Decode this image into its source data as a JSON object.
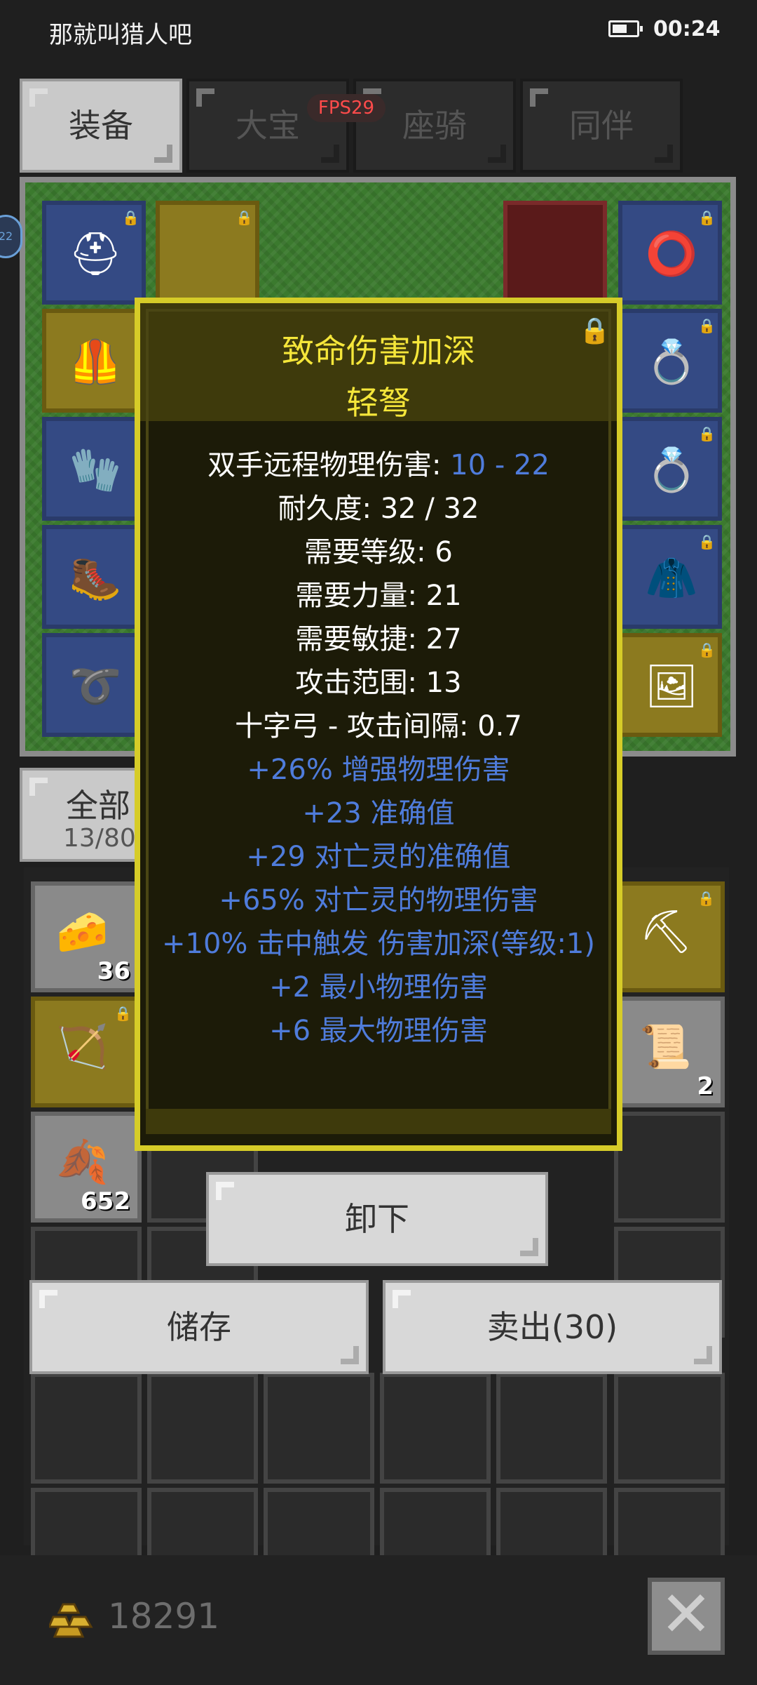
{
  "status_bar": {
    "title": "那就叫猎人吧",
    "time": "00:24"
  },
  "tabs": [
    {
      "label": "装备",
      "active": true
    },
    {
      "label": "大宝",
      "active": false
    },
    {
      "label": "座骑",
      "active": false
    },
    {
      "label": "同伴",
      "active": false
    }
  ],
  "fps": "FPS29",
  "side_badge": "22",
  "inventory": {
    "filter_label": "全部",
    "count": "13/80",
    "quantities": [
      "36",
      "652",
      "2"
    ]
  },
  "tooltip": {
    "title": "致命伤害加深",
    "item_name": "轻弩",
    "base_lines": [
      {
        "label": "双手远程物理伤害: ",
        "value": "10 - 22"
      },
      {
        "label": "耐久度: 32 / 32",
        "value": ""
      },
      {
        "label": "需要等级: 6",
        "value": ""
      },
      {
        "label": "需要力量: 21",
        "value": ""
      },
      {
        "label": "需要敏捷: 27",
        "value": ""
      },
      {
        "label": "攻击范围: 13",
        "value": ""
      },
      {
        "label": "十字弓 - 攻击间隔: 0.7",
        "value": ""
      }
    ],
    "affixes": [
      "+26% 增强物理伤害",
      "+23 准确值",
      "+29 对亡灵的准确值",
      "+65% 对亡灵的物理伤害",
      "+10% 击中触发 伤害加深(等级:1)",
      "+2 最小物理伤害",
      "+6 最大物理伤害"
    ]
  },
  "buttons": {
    "unequip": "卸下",
    "store": "储存",
    "sell": "卖出(30)"
  },
  "gold": "18291",
  "colors": {
    "affix_blue": "#4f7cdb",
    "title_yellow": "#f5e63a",
    "tooltip_border": "#d6cc28",
    "fps_red": "#ff4b4b"
  }
}
